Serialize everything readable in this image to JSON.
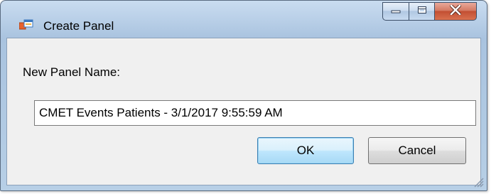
{
  "window": {
    "title": "Create Panel",
    "icon": "form-window-icon",
    "controls": {
      "minimize": "minimize-icon",
      "maximize": "maximize-icon",
      "close": "close-icon"
    }
  },
  "form": {
    "name_label": "New Panel Name:",
    "name_value": "CMET Events Patients - 3/1/2017 9:55:59 AM"
  },
  "buttons": {
    "ok_label": "OK",
    "cancel_label": "Cancel"
  },
  "colors": {
    "frame": "#b7cfe6",
    "client": "#f0f0f0",
    "close_button": "#c24f33",
    "default_button": "#3c7fb1"
  }
}
